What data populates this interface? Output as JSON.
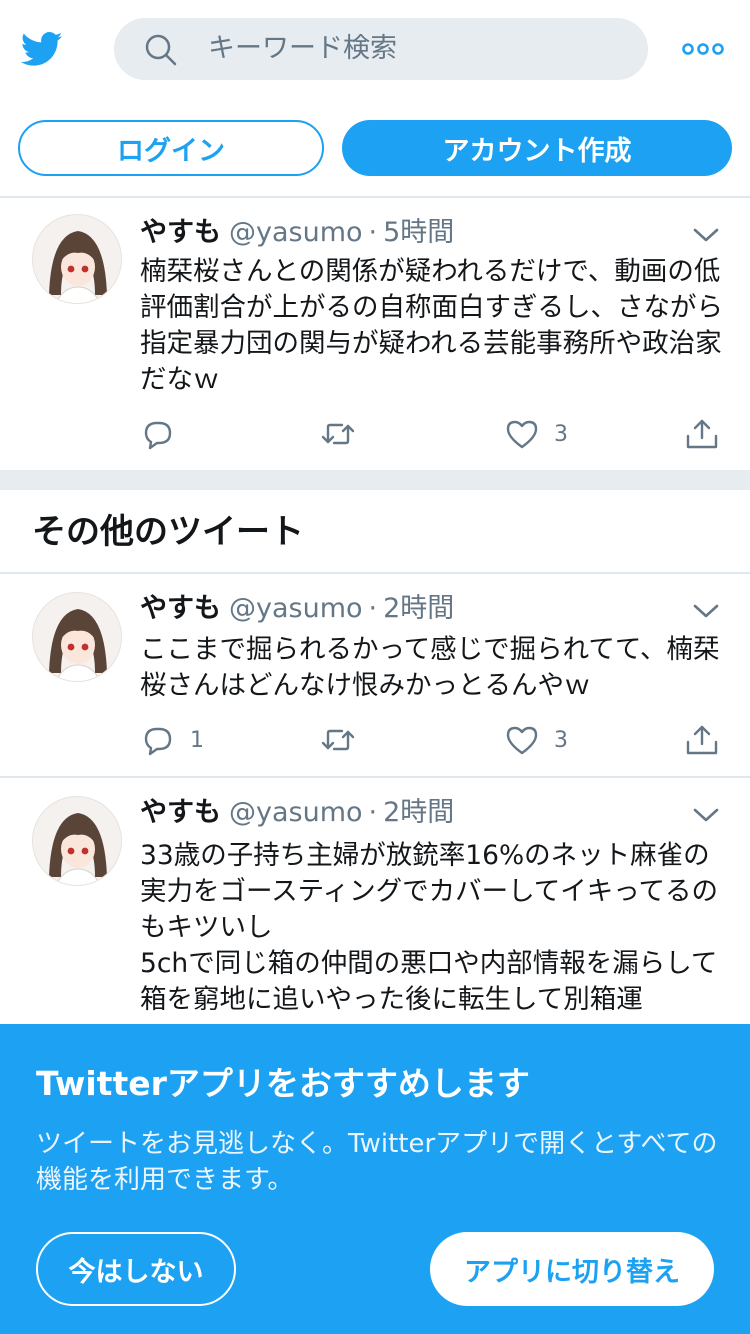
{
  "colors": {
    "brand": "#1da1f2",
    "text": "#14171a",
    "muted": "#657786",
    "divider": "#e1e8ed",
    "searchBg": "#e6ecf0"
  },
  "header": {
    "logo_icon": "twitter-bird-icon",
    "search_icon": "search-icon",
    "search_placeholder": "キーワード検索",
    "more_icon": "more-dots-icon"
  },
  "auth": {
    "login_label": "ログイン",
    "signup_label": "アカウント作成"
  },
  "tweets": [
    {
      "name": "やすも",
      "handle": "@yasumo",
      "sep": "·",
      "time": "5時間",
      "text": "楠栞桜さんとの関係が疑われるだけで、動画の低評価割合が上がるの自称面白すぎるし、さながら指定暴力団の関与が疑われる芸能事務所や政治家だなｗ",
      "reply_count": "",
      "retweet_count": "",
      "like_count": "3"
    },
    {
      "name": "やすも",
      "handle": "@yasumo",
      "sep": "·",
      "time": "2時間",
      "text": "ここまで掘られるかって感じで掘られてて、楠栞桜さんはどんなけ恨みかっとるんやｗ",
      "reply_count": "1",
      "retweet_count": "",
      "like_count": "3"
    },
    {
      "name": "やすも",
      "handle": "@yasumo",
      "sep": "·",
      "time": "2時間",
      "text": "33歳の子持ち主婦が放銃率16%のネット麻雀の実力をゴースティングでカバーしてイキってるのもキツいし\n5chで同じ箱の仲間の悪口や内部情報を漏らして箱を窮地に追いやった後に転生して別箱運"
    }
  ],
  "section": {
    "title": "その他のツイート"
  },
  "banner": {
    "title": "Twitterアプリをおすすめします",
    "desc": "ツイートをお見逃しなく。Twitterアプリで開くとすべての機能を利用できます。",
    "notnow_label": "今はしない",
    "switch_label": "アプリに切り替え"
  }
}
